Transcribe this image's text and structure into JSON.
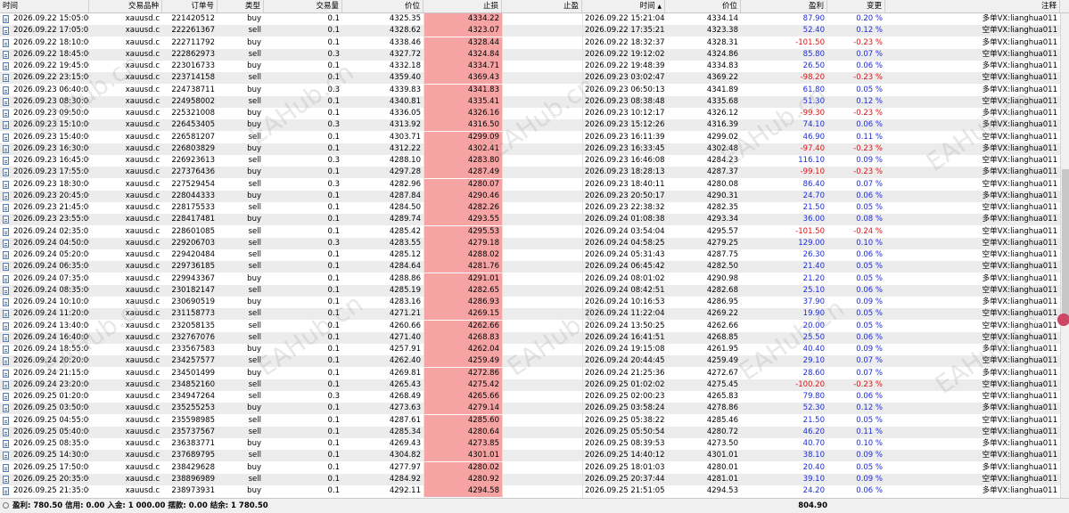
{
  "headers": {
    "time": "时间",
    "symbol": "交易品种",
    "order": "订单号",
    "type": "类型",
    "volume": "交易量",
    "price": "价位",
    "sl": "止损",
    "tp": "止盈",
    "close_time": "时间",
    "close_arrow": "▲",
    "close_price": "价位",
    "profit": "盈利",
    "change": "变更",
    "comment": "注释"
  },
  "watermark": "EAHub.cn",
  "rows": [
    [
      "2026.09.22 15:05:00",
      "xauusd.c",
      "221420512",
      "buy",
      "0.1",
      "4325.35",
      "4334.22",
      "",
      "2026.09.22 15:21:04",
      "4334.14",
      "87.90",
      "0.20 %",
      "多单VX:lianghua011"
    ],
    [
      "2026.09.22 17:05:01",
      "xauusd.c",
      "222261367",
      "sell",
      "0.1",
      "4328.62",
      "4323.07",
      "",
      "2026.09.22 17:35:21",
      "4323.38",
      "52.40",
      "0.12 %",
      "空单VX:lianghua011"
    ],
    [
      "2026.09.22 18:10:00",
      "xauusd.c",
      "222711792",
      "buy",
      "0.1",
      "4338.46",
      "4328.44",
      "",
      "2026.09.22 18:32:37",
      "4328.31",
      "-101.50",
      "-0.23 %",
      "多单VX:lianghua011"
    ],
    [
      "2026.09.22 18:45:00",
      "xauusd.c",
      "222862973",
      "sell",
      "0.3",
      "4327.72",
      "4324.84",
      "",
      "2026.09.22 19:12:02",
      "4324.86",
      "85.80",
      "0.07 %",
      "空单VX:lianghua011"
    ],
    [
      "2026.09.22 19:45:00",
      "xauusd.c",
      "223016733",
      "buy",
      "0.1",
      "4332.18",
      "4334.71",
      "",
      "2026.09.22 19:48:39",
      "4334.83",
      "26.50",
      "0.06 %",
      "多单VX:lianghua011"
    ],
    [
      "2026.09.22 23:15:00",
      "xauusd.c",
      "223714158",
      "sell",
      "0.1",
      "4359.40",
      "4369.43",
      "",
      "2026.09.23 03:02:47",
      "4369.22",
      "-98.20",
      "-0.23 %",
      "空单VX:lianghua011"
    ],
    [
      "2026.09.23 06:40:01",
      "xauusd.c",
      "224738711",
      "buy",
      "0.3",
      "4339.83",
      "4341.83",
      "",
      "2026.09.23 06:50:13",
      "4341.89",
      "61.80",
      "0.05 %",
      "多单VX:lianghua011"
    ],
    [
      "2026.09.23 08:30:00",
      "xauusd.c",
      "224958002",
      "sell",
      "0.1",
      "4340.81",
      "4335.41",
      "",
      "2026.09.23 08:38:48",
      "4335.68",
      "51.30",
      "0.12 %",
      "空单VX:lianghua011"
    ],
    [
      "2026.09.23 09:50:00",
      "xauusd.c",
      "225321008",
      "buy",
      "0.1",
      "4336.05",
      "4326.16",
      "",
      "2026.09.23 10:12:17",
      "4326.12",
      "-99.30",
      "-0.23 %",
      "多单VX:lianghua011"
    ],
    [
      "2026.09.23 15:10:00",
      "xauusd.c",
      "226453405",
      "buy",
      "0.3",
      "4313.92",
      "4316.50",
      "",
      "2026.09.23 15:12:26",
      "4316.39",
      "74.10",
      "0.06 %",
      "多单VX:lianghua011"
    ],
    [
      "2026.09.23 15:40:00",
      "xauusd.c",
      "226581207",
      "sell",
      "0.1",
      "4303.71",
      "4299.09",
      "",
      "2026.09.23 16:11:39",
      "4299.02",
      "46.90",
      "0.11 %",
      "空单VX:lianghua011"
    ],
    [
      "2026.09.23 16:30:00",
      "xauusd.c",
      "226803829",
      "buy",
      "0.1",
      "4312.22",
      "4302.41",
      "",
      "2026.09.23 16:33:45",
      "4302.48",
      "-97.40",
      "-0.23 %",
      "多单VX:lianghua011"
    ],
    [
      "2026.09.23 16:45:00",
      "xauusd.c",
      "226923613",
      "sell",
      "0.3",
      "4288.10",
      "4283.80",
      "",
      "2026.09.23 16:46:08",
      "4284.23",
      "116.10",
      "0.09 %",
      "空单VX:lianghua011"
    ],
    [
      "2026.09.23 17:55:00",
      "xauusd.c",
      "227376436",
      "buy",
      "0.1",
      "4297.28",
      "4287.49",
      "",
      "2026.09.23 18:28:13",
      "4287.37",
      "-99.10",
      "-0.23 %",
      "多单VX:lianghua011"
    ],
    [
      "2026.09.23 18:30:00",
      "xauusd.c",
      "227529454",
      "sell",
      "0.3",
      "4282.96",
      "4280.07",
      "",
      "2026.09.23 18:40:11",
      "4280.08",
      "86.40",
      "0.07 %",
      "空单VX:lianghua011"
    ],
    [
      "2026.09.23 20:45:00",
      "xauusd.c",
      "228044333",
      "buy",
      "0.1",
      "4287.84",
      "4290.46",
      "",
      "2026.09.23 20:50:17",
      "4290.31",
      "24.70",
      "0.06 %",
      "多单VX:lianghua011"
    ],
    [
      "2026.09.23 21:45:00",
      "xauusd.c",
      "228175533",
      "sell",
      "0.1",
      "4284.50",
      "4282.26",
      "",
      "2026.09.23 22:38:32",
      "4282.35",
      "21.50",
      "0.05 %",
      "空单VX:lianghua011"
    ],
    [
      "2026.09.23 23:55:00",
      "xauusd.c",
      "228417481",
      "buy",
      "0.1",
      "4289.74",
      "4293.55",
      "",
      "2026.09.24 01:08:38",
      "4293.34",
      "36.00",
      "0.08 %",
      "多单VX:lianghua011"
    ],
    [
      "2026.09.24 02:35:01",
      "xauusd.c",
      "228601085",
      "sell",
      "0.1",
      "4285.42",
      "4295.53",
      "",
      "2026.09.24 03:54:04",
      "4295.57",
      "-101.50",
      "-0.24 %",
      "空单VX:lianghua011"
    ],
    [
      "2026.09.24 04:50:00",
      "xauusd.c",
      "229206703",
      "sell",
      "0.3",
      "4283.55",
      "4279.18",
      "",
      "2026.09.24 04:58:25",
      "4279.25",
      "129.00",
      "0.10 %",
      "空单VX:lianghua011"
    ],
    [
      "2026.09.24 05:20:00",
      "xauusd.c",
      "229420484",
      "sell",
      "0.1",
      "4285.12",
      "4288.02",
      "",
      "2026.09.24 05:31:43",
      "4287.75",
      "26.30",
      "0.06 %",
      "空单VX:lianghua011"
    ],
    [
      "2026.09.24 06:35:00",
      "xauusd.c",
      "229736185",
      "sell",
      "0.1",
      "4284.64",
      "4281.76",
      "",
      "2026.09.24 06:45:42",
      "4282.50",
      "21.40",
      "0.05 %",
      "空单VX:lianghua011"
    ],
    [
      "2026.09.24 07:35:00",
      "xauusd.c",
      "229943367",
      "buy",
      "0.1",
      "4288.86",
      "4291.01",
      "",
      "2026.09.24 08:01:02",
      "4290.98",
      "21.20",
      "0.05 %",
      "多单VX:lianghua011"
    ],
    [
      "2026.09.24 08:35:00",
      "xauusd.c",
      "230182147",
      "sell",
      "0.1",
      "4285.19",
      "4282.65",
      "",
      "2026.09.24 08:42:51",
      "4282.68",
      "25.10",
      "0.06 %",
      "空单VX:lianghua011"
    ],
    [
      "2026.09.24 10:10:00",
      "xauusd.c",
      "230690519",
      "buy",
      "0.1",
      "4283.16",
      "4286.93",
      "",
      "2026.09.24 10:16:53",
      "4286.95",
      "37.90",
      "0.09 %",
      "多单VX:lianghua011"
    ],
    [
      "2026.09.24 11:20:00",
      "xauusd.c",
      "231158773",
      "sell",
      "0.1",
      "4271.21",
      "4269.15",
      "",
      "2026.09.24 11:22:04",
      "4269.22",
      "19.90",
      "0.05 %",
      "空单VX:lianghua011"
    ],
    [
      "2026.09.24 13:40:00",
      "xauusd.c",
      "232058135",
      "sell",
      "0.1",
      "4260.66",
      "4262.66",
      "",
      "2026.09.24 13:50:25",
      "4262.66",
      "20.00",
      "0.05 %",
      "空单VX:lianghua011"
    ],
    [
      "2026.09.24 16:40:00",
      "xauusd.c",
      "232767076",
      "sell",
      "0.1",
      "4271.40",
      "4268.83",
      "",
      "2026.09.24 16:41:51",
      "4268.85",
      "25.50",
      "0.06 %",
      "空单VX:lianghua011"
    ],
    [
      "2026.09.24 18:55:00",
      "xauusd.c",
      "233567583",
      "buy",
      "0.1",
      "4257.91",
      "4262.04",
      "",
      "2026.09.24 19:15:08",
      "4261.95",
      "40.40",
      "0.09 %",
      "多单VX:lianghua011"
    ],
    [
      "2026.09.24 20:20:00",
      "xauusd.c",
      "234257577",
      "sell",
      "0.1",
      "4262.40",
      "4259.49",
      "",
      "2026.09.24 20:44:45",
      "4259.49",
      "29.10",
      "0.07 %",
      "空单VX:lianghua011"
    ],
    [
      "2026.09.24 21:15:00",
      "xauusd.c",
      "234501499",
      "buy",
      "0.1",
      "4269.81",
      "4272.86",
      "",
      "2026.09.24 21:25:36",
      "4272.67",
      "28.60",
      "0.07 %",
      "多单VX:lianghua011"
    ],
    [
      "2026.09.24 23:20:00",
      "xauusd.c",
      "234852160",
      "sell",
      "0.1",
      "4265.43",
      "4275.42",
      "",
      "2026.09.25 01:02:02",
      "4275.45",
      "-100.20",
      "-0.23 %",
      "空单VX:lianghua011"
    ],
    [
      "2026.09.25 01:20:00",
      "xauusd.c",
      "234947264",
      "sell",
      "0.3",
      "4268.49",
      "4265.66",
      "",
      "2026.09.25 02:00:23",
      "4265.83",
      "79.80",
      "0.06 %",
      "空单VX:lianghua011"
    ],
    [
      "2026.09.25 03:50:00",
      "xauusd.c",
      "235255253",
      "buy",
      "0.1",
      "4273.63",
      "4279.14",
      "",
      "2026.09.25 03:58:24",
      "4278.86",
      "52.30",
      "0.12 %",
      "多单VX:lianghua011"
    ],
    [
      "2026.09.25 04:55:00",
      "xauusd.c",
      "235598985",
      "sell",
      "0.1",
      "4287.61",
      "4285.60",
      "",
      "2026.09.25 05:38:22",
      "4285.46",
      "21.50",
      "0.05 %",
      "空单VX:lianghua011"
    ],
    [
      "2026.09.25 05:40:00",
      "xauusd.c",
      "235737567",
      "sell",
      "0.1",
      "4285.34",
      "4280.64",
      "",
      "2026.09.25 05:50:54",
      "4280.72",
      "46.20",
      "0.11 %",
      "空单VX:lianghua011"
    ],
    [
      "2026.09.25 08:35:00",
      "xauusd.c",
      "236383771",
      "buy",
      "0.1",
      "4269.43",
      "4273.85",
      "",
      "2026.09.25 08:39:53",
      "4273.50",
      "40.70",
      "0.10 %",
      "多单VX:lianghua011"
    ],
    [
      "2026.09.25 14:30:00",
      "xauusd.c",
      "237689795",
      "sell",
      "0.1",
      "4304.82",
      "4301.01",
      "",
      "2026.09.25 14:40:12",
      "4301.01",
      "38.10",
      "0.09 %",
      "空单VX:lianghua011"
    ],
    [
      "2026.09.25 17:50:00",
      "xauusd.c",
      "238429628",
      "buy",
      "0.1",
      "4277.97",
      "4280.02",
      "",
      "2026.09.25 18:01:03",
      "4280.01",
      "20.40",
      "0.05 %",
      "多单VX:lianghua011"
    ],
    [
      "2026.09.25 20:35:00",
      "xauusd.c",
      "238896989",
      "sell",
      "0.1",
      "4284.92",
      "4280.92",
      "",
      "2026.09.25 20:37:44",
      "4281.01",
      "39.10",
      "0.09 %",
      "空单VX:lianghua011"
    ],
    [
      "2026.09.25 21:35:00",
      "xauusd.c",
      "238973931",
      "buy",
      "0.1",
      "4292.11",
      "4294.58",
      "",
      "2026.09.25 21:51:05",
      "4294.53",
      "24.20",
      "0.06 %",
      "多单VX:lianghua011"
    ]
  ],
  "status": {
    "summary": "盈利: 780.50  信用: 0.00  入金: 1 000.00  摆款: 0.00  结余: 1 780.50",
    "total": "804.90"
  }
}
